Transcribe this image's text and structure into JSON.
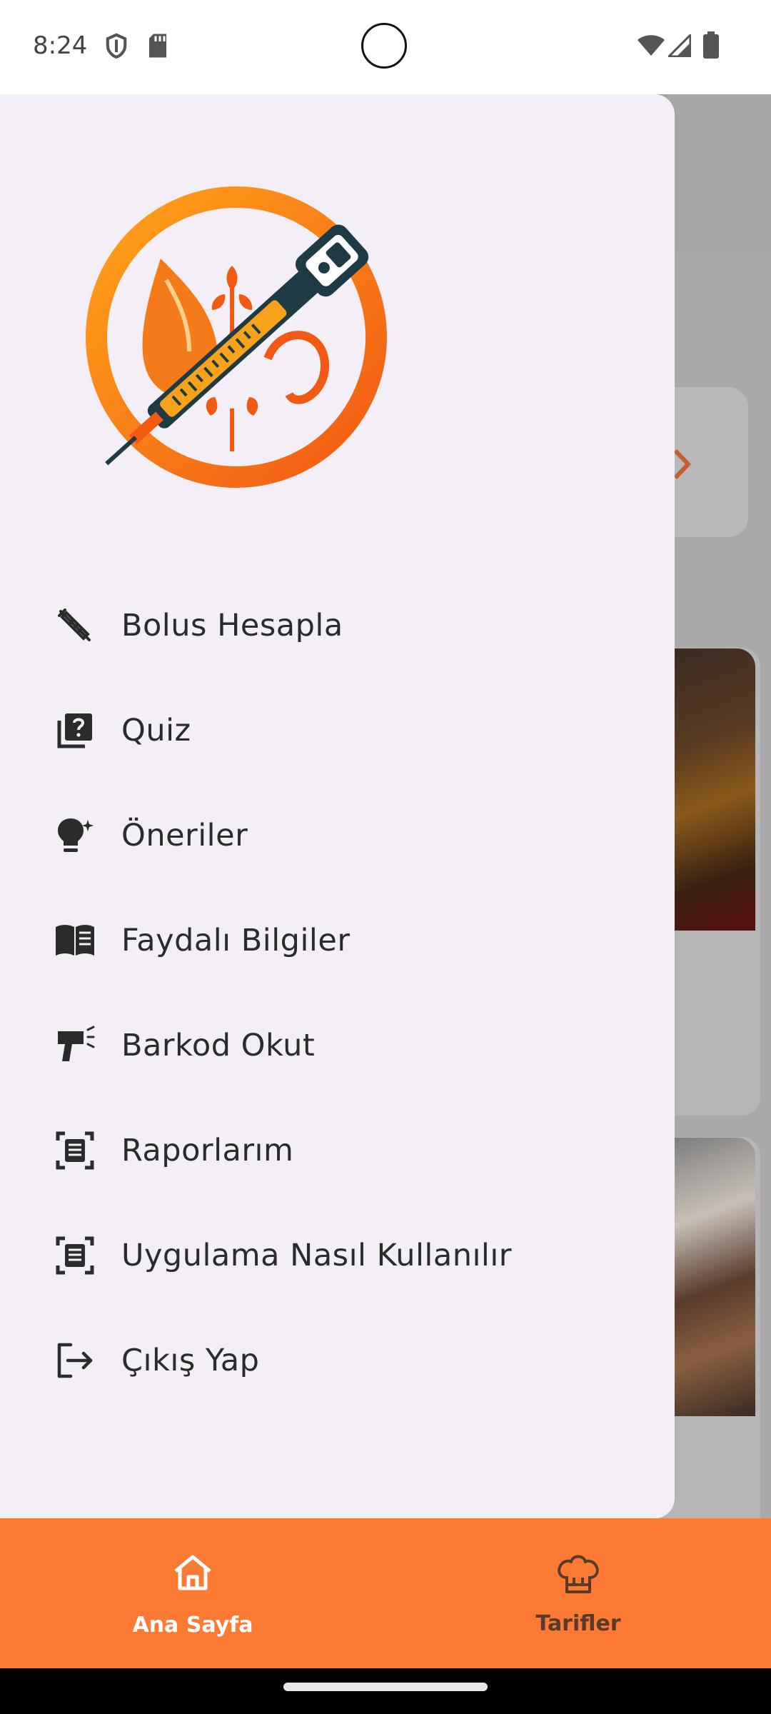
{
  "status_bar": {
    "time": "8:24",
    "left_icons": [
      "shield-icon",
      "sd-card-icon"
    ],
    "right_icons": [
      "wifi-icon",
      "signal-icon",
      "battery-icon"
    ]
  },
  "drawer": {
    "logo": "diabetes-app-logo",
    "menu": [
      {
        "label": "Bolus Hesapla",
        "icon": "syringe-icon"
      },
      {
        "label": "Quiz",
        "icon": "quiz-icon"
      },
      {
        "label": "Öneriler",
        "icon": "lightbulb-icon"
      },
      {
        "label": "Faydalı Bilgiler",
        "icon": "book-icon"
      },
      {
        "label": "Barkod Okut",
        "icon": "barcode-scanner-icon"
      },
      {
        "label": "Raporlarım",
        "icon": "document-scan-icon"
      },
      {
        "label": "Uygulama Nasıl Kullanılır",
        "icon": "document-scan-icon"
      },
      {
        "label": "Çıkış Yap",
        "icon": "logout-icon"
      }
    ]
  },
  "bottom_nav": {
    "items": [
      {
        "label": "Ana Sayfa",
        "icon": "home-icon",
        "active": true
      },
      {
        "label": "Tarifler",
        "icon": "chef-hat-icon",
        "active": false
      }
    ]
  },
  "colors": {
    "accent": "#fd7a35",
    "drawer_bg": "#f4eff6",
    "active_nav_text": "#ffffff",
    "inactive_nav_text": "#5a3a2a"
  }
}
